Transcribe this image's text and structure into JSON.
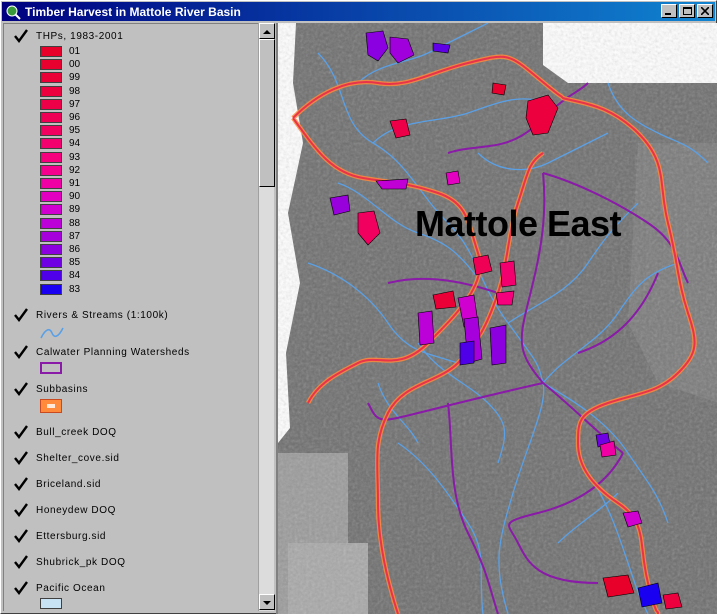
{
  "window": {
    "title": "Timber Harvest in Mattole River Basin"
  },
  "toc": {
    "thp_layer": {
      "label": "THPs, 1983-2001",
      "classes": [
        {
          "label": "01",
          "color": "#e8002a"
        },
        {
          "label": "00",
          "color": "#e8002e"
        },
        {
          "label": "99",
          "color": "#ea0036"
        },
        {
          "label": "98",
          "color": "#ec003e"
        },
        {
          "label": "97",
          "color": "#ee0048"
        },
        {
          "label": "96",
          "color": "#f00054"
        },
        {
          "label": "95",
          "color": "#f20060"
        },
        {
          "label": "94",
          "color": "#f4006e"
        },
        {
          "label": "93",
          "color": "#f6007e"
        },
        {
          "label": "92",
          "color": "#f5008e"
        },
        {
          "label": "91",
          "color": "#f000a4"
        },
        {
          "label": "90",
          "color": "#e400c0"
        },
        {
          "label": "89",
          "color": "#d000d0"
        },
        {
          "label": "88",
          "color": "#bc00d8"
        },
        {
          "label": "87",
          "color": "#a600dc"
        },
        {
          "label": "86",
          "color": "#8c00e0"
        },
        {
          "label": "85",
          "color": "#7000e4"
        },
        {
          "label": "84",
          "color": "#5000e8"
        },
        {
          "label": "83",
          "color": "#1a00f0"
        }
      ]
    },
    "layers": [
      {
        "label": "Rivers & Streams (1:100k)",
        "legend": "river-line"
      },
      {
        "label": "Calwater Planning Watersheds",
        "legend": "purple-box"
      },
      {
        "label": "Subbasins",
        "legend": "orange-box"
      },
      {
        "label": "Bull_creek DOQ",
        "legend": ""
      },
      {
        "label": "Shelter_cove.sid",
        "legend": ""
      },
      {
        "label": "Briceland.sid",
        "legend": ""
      },
      {
        "label": "Honeydew DOQ",
        "legend": ""
      },
      {
        "label": "Ettersburg.sid",
        "legend": ""
      },
      {
        "label": "Shubrick_pk DOQ",
        "legend": ""
      },
      {
        "label": "Pacific Ocean",
        "legend": "ocean-box"
      }
    ]
  },
  "map": {
    "label": "Mattole East",
    "colors": {
      "subbasin": "#e8334a",
      "subbasin_outline": "#ff8a3c",
      "watershed": "#8a1aa8",
      "river": "#5aa0e6"
    }
  }
}
